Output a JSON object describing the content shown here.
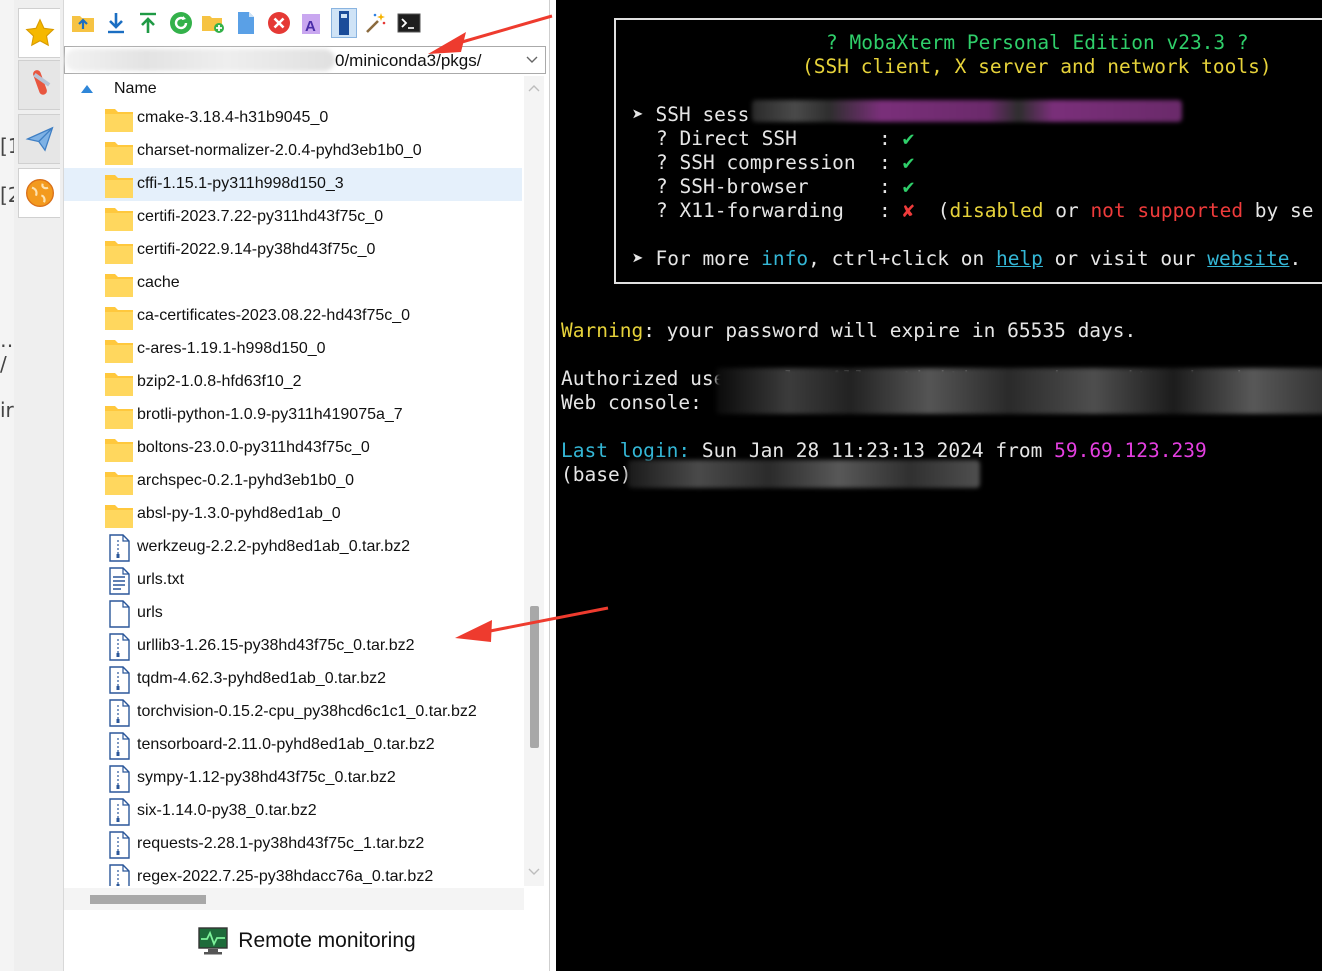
{
  "window_edge": {
    "glyphs": [
      "[1",
      "[2",
      "…",
      "/",
      "ir"
    ]
  },
  "side_tabs": [
    {
      "name": "star-icon"
    },
    {
      "name": "tools-icon"
    },
    {
      "name": "send-icon"
    },
    {
      "name": "globe-icon"
    }
  ],
  "toolbar": {
    "icons": [
      "folder-up-icon",
      "download-icon",
      "upload-icon",
      "refresh-icon",
      "new-folder-icon",
      "new-file-icon",
      "delete-icon",
      "rename-icon",
      "follow-terminal-icon",
      "magic-wand-icon",
      "terminal-icon"
    ]
  },
  "sftp": {
    "path": "0/miniconda3/pkgs/",
    "column_name": "Name",
    "files": [
      {
        "name": "cmake-3.18.4-h31b9045_0",
        "type": "folder"
      },
      {
        "name": "charset-normalizer-2.0.4-pyhd3eb1b0_0",
        "type": "folder"
      },
      {
        "name": "cffi-1.15.1-py311h998d150_3",
        "type": "folder",
        "selected": true
      },
      {
        "name": "certifi-2023.7.22-py311hd43f75c_0",
        "type": "folder"
      },
      {
        "name": "certifi-2022.9.14-py38hd43f75c_0",
        "type": "folder"
      },
      {
        "name": "cache",
        "type": "folder"
      },
      {
        "name": "ca-certificates-2023.08.22-hd43f75c_0",
        "type": "folder"
      },
      {
        "name": "c-ares-1.19.1-h998d150_0",
        "type": "folder"
      },
      {
        "name": "bzip2-1.0.8-hfd63f10_2",
        "type": "folder"
      },
      {
        "name": "brotli-python-1.0.9-py311h419075a_7",
        "type": "folder"
      },
      {
        "name": "boltons-23.0.0-py311hd43f75c_0",
        "type": "folder"
      },
      {
        "name": "archspec-0.2.1-pyhd3eb1b0_0",
        "type": "folder"
      },
      {
        "name": "absl-py-1.3.0-pyhd8ed1ab_0",
        "type": "folder"
      },
      {
        "name": "werkzeug-2.2.2-pyhd8ed1ab_0.tar.bz2",
        "type": "archive"
      },
      {
        "name": "urls.txt",
        "type": "text"
      },
      {
        "name": "urls",
        "type": "blank"
      },
      {
        "name": "urllib3-1.26.15-py38hd43f75c_0.tar.bz2",
        "type": "archive"
      },
      {
        "name": "tqdm-4.62.3-pyhd8ed1ab_0.tar.bz2",
        "type": "archive"
      },
      {
        "name": "torchvision-0.15.2-cpu_py38hcd6c1c1_0.tar.bz2",
        "type": "archive"
      },
      {
        "name": "tensorboard-2.11.0-pyhd8ed1ab_0.tar.bz2",
        "type": "archive"
      },
      {
        "name": "sympy-1.12-py38hd43f75c_0.tar.bz2",
        "type": "archive"
      },
      {
        "name": "six-1.14.0-py38_0.tar.bz2",
        "type": "archive"
      },
      {
        "name": "requests-2.28.1-py38hd43f75c_1.tar.bz2",
        "type": "archive"
      },
      {
        "name": "regex-2022.7.25-py38hdacc76a_0.tar.bz2",
        "type": "archive"
      }
    ],
    "remote_monitoring_label": "Remote monitoring"
  },
  "terminal": {
    "banner_title": "? MobaXterm Personal Edition v23.3 ?",
    "banner_subtitle": "(SSH client, X server and network tools)",
    "ssh_session_prefix": "➤ SSH sess",
    "direct_ssh": "? Direct SSH       :",
    "ssh_compression": "? SSH compression  :",
    "ssh_browser": "? SSH-browser      :",
    "x11_forwarding": "? X11-forwarding   :",
    "check": "✔",
    "cross": "✘",
    "x11_open": "(",
    "x11_disabled": "disabled",
    "x11_or": " or ",
    "x11_not_supported": "not supported",
    "x11_by": " by se",
    "more_info_prefix": "➤ For more ",
    "more_info_info": "info",
    "more_info_mid": ", ctrl+click on ",
    "more_info_help": "help",
    "more_info_or": " or visit our ",
    "more_info_website": "website",
    "more_info_end": ".",
    "warning_label": "Warning",
    "warning_text": ": your password will expire in 65535 days.",
    "authorized_text": "Authorized users only. All activities may be monitored and repor",
    "web_console_label": "Web console:",
    "last_login_label": "Last login:",
    "last_login_text": " Sun Jan 28 11:23:13 2024 from ",
    "last_login_ip": "59.69.123.239",
    "prompt": "(base)"
  },
  "colors": {
    "terminal_bg": "#000000",
    "terminal_text": "#e6e6e6",
    "yellow": "#e6d23a",
    "red": "#ef3b3b",
    "green": "#2fcf6a",
    "cyan": "#34b7d6",
    "magenta": "#e43fe0",
    "annotation_arrow": "#ee3b2e",
    "folder": "#ffc83d",
    "selection": "#e5f0fb"
  }
}
